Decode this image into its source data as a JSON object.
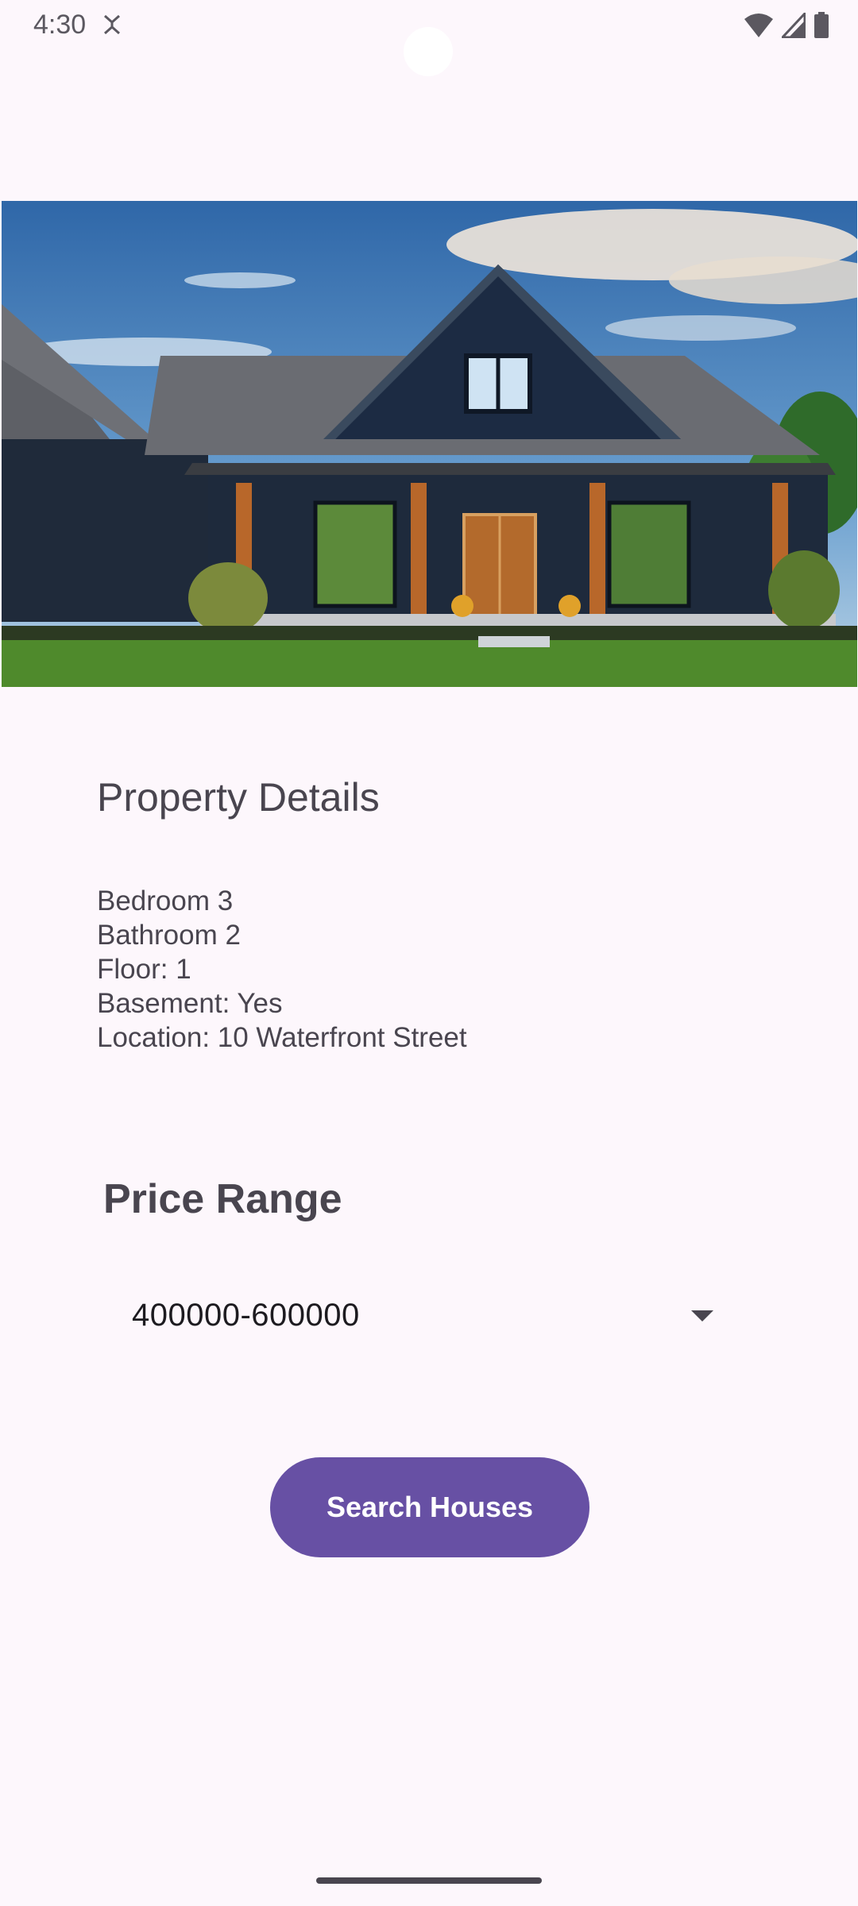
{
  "status_bar": {
    "time": "4:30",
    "left_icons": [
      "sync-icon"
    ],
    "right_icons": [
      "wifi-icon",
      "signal-icon",
      "battery-icon"
    ]
  },
  "hero_image": {
    "subject": "house-photo"
  },
  "property_details": {
    "title": "Property Details",
    "items": [
      "Bedroom 3",
      "Bathroom 2",
      "Floor: 1",
      "Basement: Yes",
      "Location: 10 Waterfront Street"
    ]
  },
  "price_range": {
    "title": "Price Range",
    "selected": "400000-600000",
    "icon": "dropdown-arrow-icon"
  },
  "search_button": {
    "label": "Search Houses"
  },
  "colors": {
    "background": "#FDF7FC",
    "primary": "#6750A4",
    "text": "#49454F",
    "on_primary": "#FFFFFF"
  }
}
